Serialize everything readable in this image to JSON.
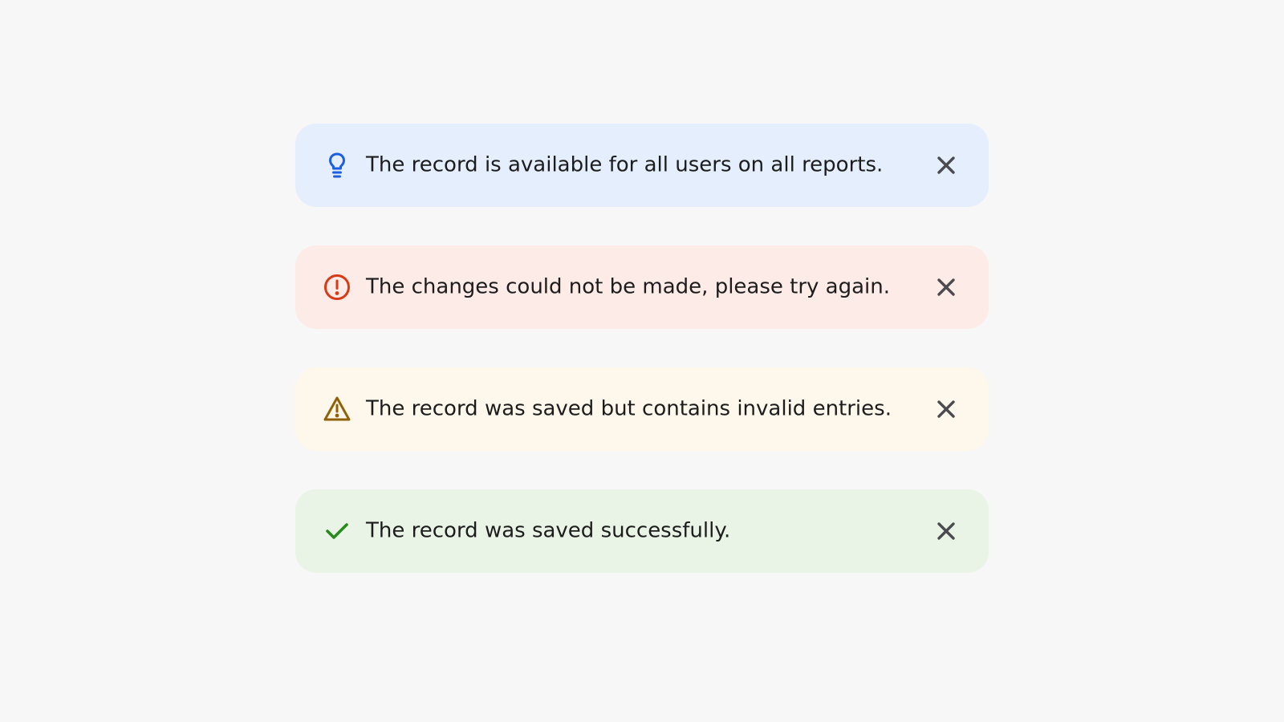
{
  "alerts": [
    {
      "type": "info",
      "icon": "lightbulb-icon",
      "message": "The record is available for all users on all reports.",
      "background": "#e4eefc",
      "icon_color": "#1b5fe0"
    },
    {
      "type": "error",
      "icon": "exclamation-circle-icon",
      "message": "The changes could not be made, please try again.",
      "background": "#fdebe8",
      "icon_color": "#d93a14"
    },
    {
      "type": "warning",
      "icon": "warning-triangle-icon",
      "message": "The record was saved but contains invalid entries.",
      "background": "#fef8ec",
      "icon_color": "#8f6208"
    },
    {
      "type": "success",
      "icon": "checkmark-icon",
      "message": "The record was saved successfully.",
      "background": "#e9f4e7",
      "icon_color": "#2a8a1e"
    }
  ],
  "close_icon": "close-icon",
  "close_color": "#4a4a4f"
}
